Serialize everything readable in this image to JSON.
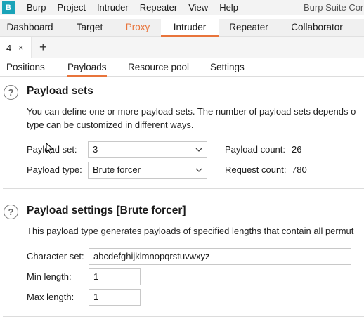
{
  "menubar": {
    "logo": "B",
    "items": [
      "Burp",
      "Project",
      "Intruder",
      "Repeater",
      "View",
      "Help"
    ],
    "app_title": "Burp Suite Cor"
  },
  "main_tabs": [
    "Dashboard",
    "Target",
    "Proxy",
    "Intruder",
    "Repeater",
    "Collaborator"
  ],
  "active_main_tab": "Intruder",
  "instance_tabs": {
    "tab_label": "4",
    "close_glyph": "×",
    "add_glyph": "+"
  },
  "sub_tabs": [
    "Positions",
    "Payloads",
    "Resource pool",
    "Settings"
  ],
  "active_sub_tab": "Payloads",
  "payload_sets": {
    "help_glyph": "?",
    "title": "Payload sets",
    "desc_line1": "You can define one or more payload sets. The number of payload sets depends o",
    "desc_line2": "type can be customized in different ways.",
    "set_label": "Payload set:",
    "set_value": "3",
    "type_label": "Payload type:",
    "type_value": "Brute forcer",
    "count_label": "Payload count:",
    "count_value": "26",
    "request_label": "Request count:",
    "request_value": "780"
  },
  "payload_settings": {
    "help_glyph": "?",
    "title": "Payload settings [Brute forcer]",
    "desc": "This payload type generates payloads of specified lengths that contain all permut",
    "charset_label": "Character set:",
    "charset_value": "abcdefghijklmnopqrstuvwxyz",
    "min_label": "Min length:",
    "min_value": "1",
    "max_label": "Max length:",
    "max_value": "1"
  },
  "colors": {
    "accent": "#e8743b",
    "logo": "#1aa3b8"
  },
  "icons": [
    "burp-logo-icon",
    "close-icon",
    "plus-icon",
    "help-icon",
    "chevron-down-icon",
    "mouse-cursor-icon"
  ]
}
